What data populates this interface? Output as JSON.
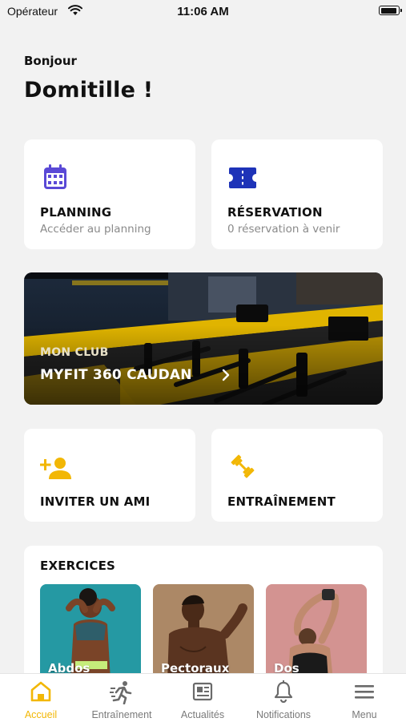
{
  "status_bar": {
    "carrier": "Opérateur",
    "time": "11:06 AM"
  },
  "greeting": "Bonjour",
  "username": "Domitille !",
  "cards": {
    "planning": {
      "title": "PLANNING",
      "subtitle": "Accéder au planning",
      "icon": "calendar-icon",
      "icon_color": "#5a49d6"
    },
    "reservation": {
      "title": "RÉSERVATION",
      "subtitle": "0 réservation à venir",
      "icon": "ticket-icon",
      "icon_color": "#1e33b8"
    },
    "invite": {
      "title": "INVITER UN AMI",
      "icon": "add-person-icon",
      "icon_color": "#f2b705"
    },
    "training": {
      "title": "ENTRAÎNEMENT",
      "icon": "dumbbell-icon",
      "icon_color": "#f2b705"
    }
  },
  "club": {
    "label": "MON CLUB",
    "name": "MYFIT 360 CAUDAN"
  },
  "exercises": {
    "title": "EXERCICES",
    "items": [
      {
        "label": "Abdos"
      },
      {
        "label": "Pectoraux"
      },
      {
        "label": "Dos"
      }
    ]
  },
  "tabs": [
    {
      "label": "Accueil",
      "icon": "home-icon",
      "active": true
    },
    {
      "label": "Entraînement",
      "icon": "running-icon",
      "active": false
    },
    {
      "label": "Actualités",
      "icon": "news-icon",
      "active": false
    },
    {
      "label": "Notifications",
      "icon": "bell-icon",
      "active": false
    },
    {
      "label": "Menu",
      "icon": "menu-icon",
      "active": false
    }
  ],
  "colors": {
    "accent": "#f2b705",
    "background": "#f2f2f2",
    "card": "#ffffff"
  }
}
